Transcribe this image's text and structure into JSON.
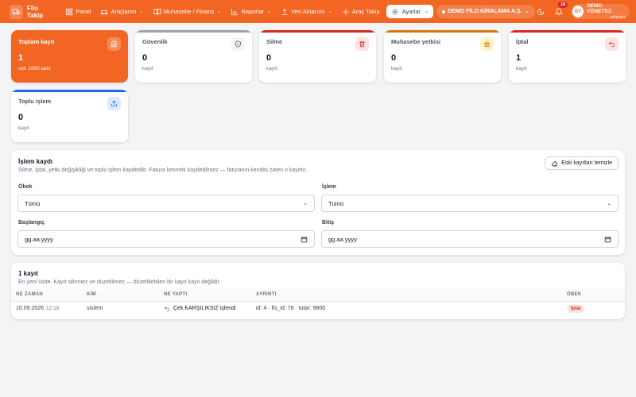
{
  "topbar": {
    "brand": "Filo Takip",
    "nav": [
      {
        "label": "Panel",
        "icon": "grid-icon",
        "dropdown": false
      },
      {
        "label": "Araçlarım",
        "icon": "car-icon",
        "dropdown": true
      },
      {
        "label": "Muhasebe / Finans",
        "icon": "book-icon",
        "dropdown": true
      },
      {
        "label": "Raporlar",
        "icon": "chart-icon",
        "dropdown": true
      },
      {
        "label": "Veri Aktarımı",
        "icon": "upload-icon",
        "dropdown": true
      },
      {
        "label": "Araç Takip",
        "icon": "location-icon",
        "dropdown": false
      }
    ],
    "settings_label": "Ayarlar",
    "company": "DEMO FİLO KİRALAMA A.Ş.",
    "notification_count": "16",
    "user_initials": "DY",
    "user_name": "DEMO YÖNETİCİ",
    "user_role": "yönetici",
    "accent_color": "#f26522"
  },
  "stats": [
    {
      "label": "Toplam kayıt",
      "value": "1",
      "sub": "son 1000 satır",
      "icon": "scroll-icon",
      "color": "#f26522"
    },
    {
      "label": "Güvenlik",
      "value": "0",
      "sub": "kayıt",
      "icon": "shield-icon",
      "color": "#9ca3af"
    },
    {
      "label": "Silme",
      "value": "0",
      "sub": "kayıt",
      "icon": "trash-icon",
      "color": "#dc2626"
    },
    {
      "label": "Muhasebe yetkisi",
      "value": "0",
      "sub": "kayıt",
      "icon": "bank-icon",
      "color": "#d97706"
    },
    {
      "label": "İptal",
      "value": "1",
      "sub": "kayıt",
      "icon": "undo-icon",
      "color": "#dc2626"
    },
    {
      "label": "Toplu işlem",
      "value": "0",
      "sub": "kayıt",
      "icon": "share-icon",
      "color": "#2563eb"
    }
  ],
  "filters": {
    "title": "İşlem kaydı",
    "description": "Silme, iptal, yetki değişikliği ve toplu işlem kaydedilir. Fatura kesmek kaydedilmez — faturanın kendisi zaten o kayıttır.",
    "clear_button": "Eski kayıtları temizle",
    "group_label": "Öbek",
    "group_value": "Tümü",
    "action_label": "İşlem",
    "action_value": "Tümü",
    "start_label": "Başlangıç",
    "start_placeholder": "gg.aa.yyyy",
    "end_label": "Bitiş",
    "end_placeholder": "gg.aa.yyyy"
  },
  "results": {
    "title": "1 kayıt",
    "description": "En yeni üstte. Kayıt silinmez ve düzeltilmez — düzeltilebilen bir kayıt kayıt değildir.",
    "columns": [
      "NE ZAMAN",
      "KİM",
      "NE YAPTI",
      "AYRINTI",
      "ÖBEK"
    ],
    "rows": [
      {
        "date": "10.09.2026",
        "time": "12:16",
        "who": "sistem",
        "action": "Çek KARŞILIKSIZ işlendi",
        "detail": "id: 4 · fis_id: 78 · tutar: 9800",
        "group": "İptal"
      }
    ]
  }
}
